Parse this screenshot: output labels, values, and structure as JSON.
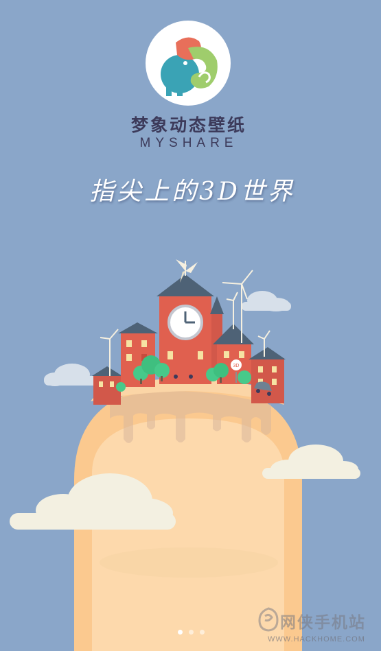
{
  "app": {
    "name_cn": "梦象动态壁纸",
    "name_en": "MYSHARE",
    "tagline": "指尖上的3D世界",
    "logo_icon": "elephant-logo-icon"
  },
  "scene": {
    "sign_text": "3D"
  },
  "pager": {
    "count": 3,
    "active_index": 0
  },
  "watermark": {
    "text": "网侠手机站",
    "url": "WWW.HACKHOME.COM"
  },
  "colors": {
    "background": "#8aa6c9",
    "brand_text": "#3c3a5a",
    "building_red": "#e0604f",
    "roof_slate": "#4e6276",
    "finger": "#fbc98f",
    "cloud": "#f3f0e1",
    "tree": "#47c98a"
  }
}
